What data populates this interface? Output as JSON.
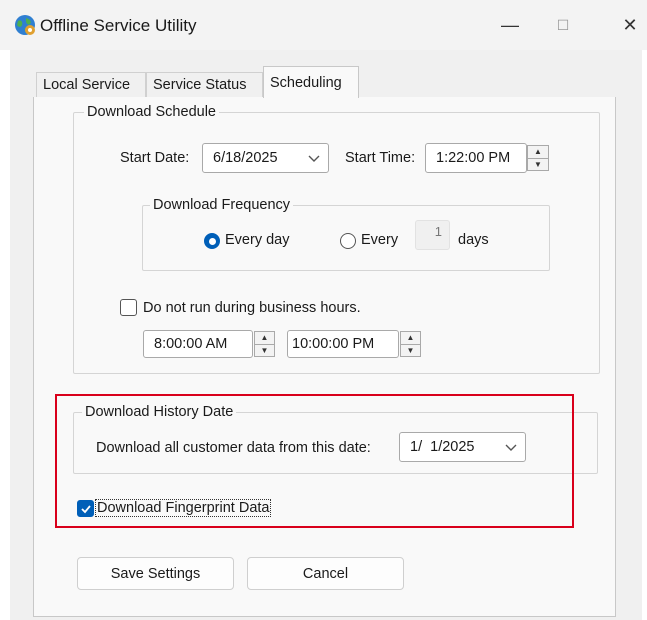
{
  "window": {
    "title": "Offline Service Utility",
    "icon": "globe-app-icon",
    "controls": {
      "minimize": "—",
      "maximize": "☐",
      "close": "✕"
    }
  },
  "tabs": [
    {
      "label": "Local Service",
      "active": false
    },
    {
      "label": "Service Status",
      "active": false
    },
    {
      "label": "Scheduling",
      "active": true
    }
  ],
  "download_schedule": {
    "title": "Download Schedule",
    "start_date_label": "Start Date:",
    "start_date_value": "6/18/2025",
    "start_time_label": "Start Time:",
    "start_time_value": "1:22:00 PM",
    "frequency": {
      "title": "Download Frequency",
      "every_day_label": "Every day",
      "every_day_selected": true,
      "every_label": "Every",
      "every_n_value": "1",
      "days_label": "days"
    },
    "business_hours": {
      "label": "Do not run during business hours.",
      "checked": false,
      "from_value": "8:00:00 AM",
      "to_value": "10:00:00 PM"
    }
  },
  "download_history": {
    "title": "Download History Date",
    "label": "Download all customer data from this date:",
    "date_value": "1/  1/2025"
  },
  "fingerprint": {
    "label": "Download Fingerprint Data",
    "checked": true
  },
  "buttons": {
    "save": "Save Settings",
    "cancel": "Cancel"
  },
  "colors": {
    "accent": "#005fb8",
    "highlight_box": "#d9001b"
  }
}
